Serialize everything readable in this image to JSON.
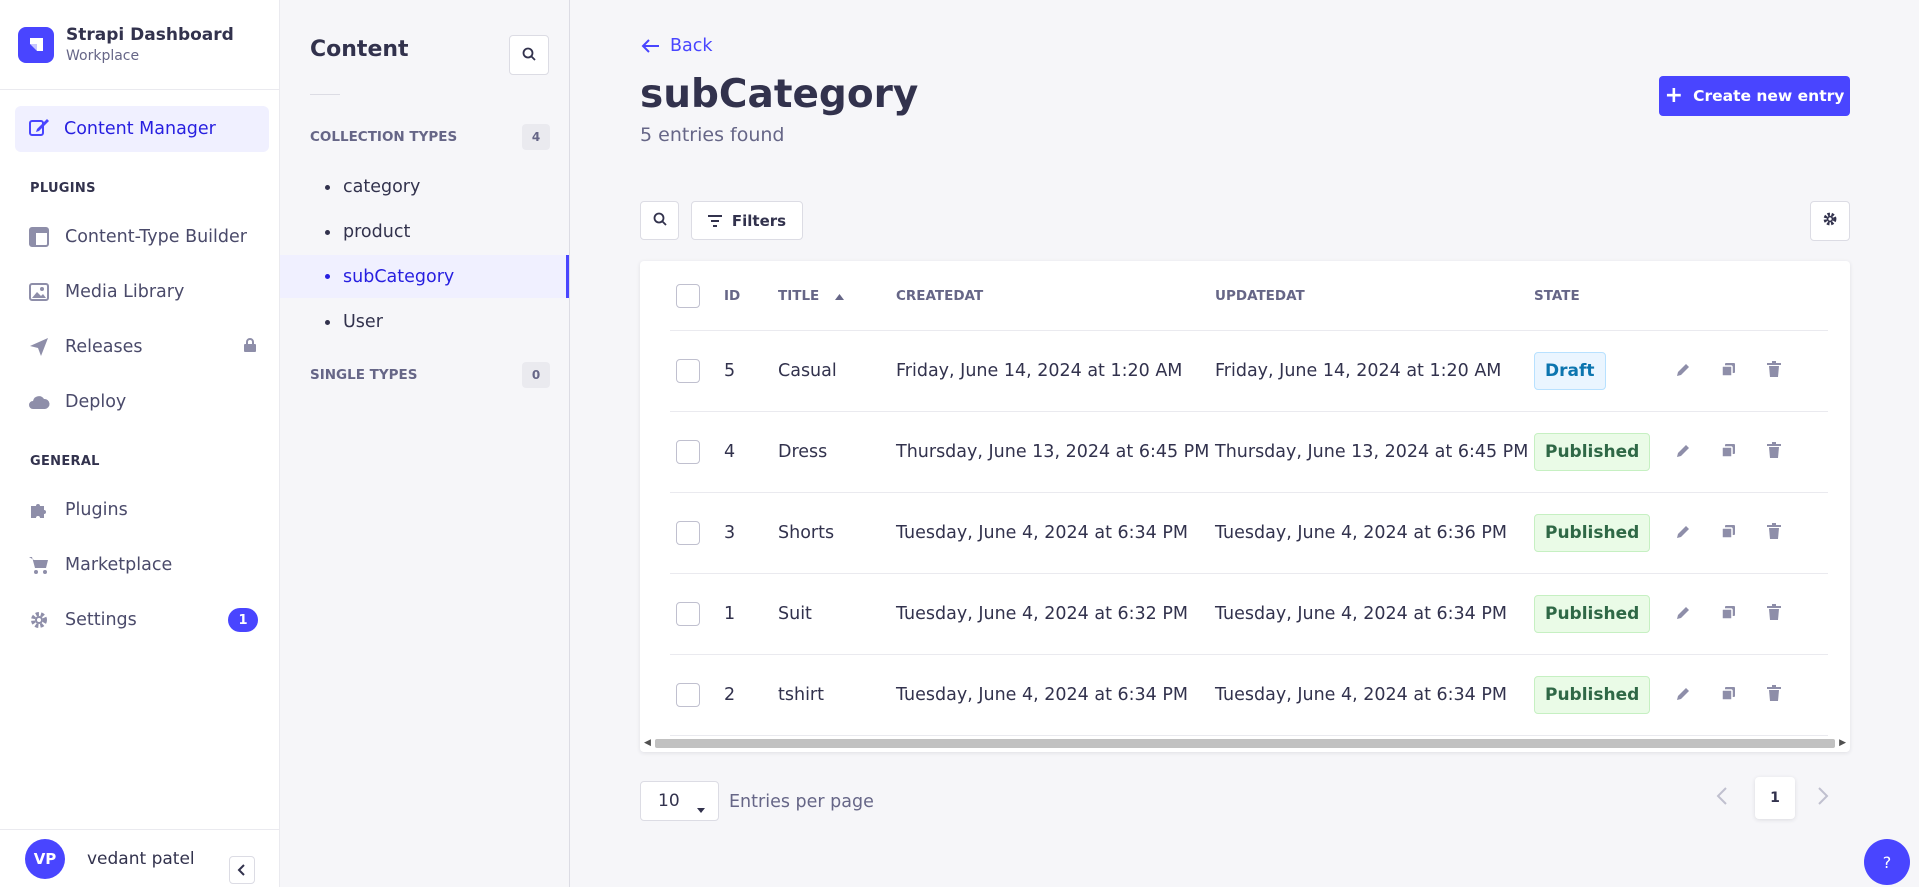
{
  "brand": {
    "title": "Strapi Dashboard",
    "subtitle": "Workplace"
  },
  "mainnav": {
    "active": {
      "label": "Content Manager",
      "icon": "feather-pen-icon"
    },
    "sections": {
      "plugins": "PLUGINS",
      "general": "GENERAL"
    },
    "plugins": [
      {
        "label": "Content-Type Builder",
        "icon": "layout-icon"
      },
      {
        "label": "Media Library",
        "icon": "image-icon"
      },
      {
        "label": "Releases",
        "icon": "paper-plane-icon",
        "trail_icon": "lock-icon"
      },
      {
        "label": "Deploy",
        "icon": "cloud-icon"
      }
    ],
    "general": [
      {
        "label": "Plugins",
        "icon": "puzzle-icon"
      },
      {
        "label": "Marketplace",
        "icon": "cart-icon"
      },
      {
        "label": "Settings",
        "icon": "gear-icon",
        "badge": "1"
      }
    ],
    "user": {
      "initials": "VP",
      "name": "vedant patel"
    }
  },
  "subnav": {
    "title": "Content",
    "collection_types": {
      "label": "COLLECTION TYPES",
      "count": "4"
    },
    "single_types": {
      "label": "SINGLE TYPES",
      "count": "0"
    },
    "items": [
      "category",
      "product",
      "subCategory",
      "User"
    ]
  },
  "header": {
    "back": "Back",
    "title": "subCategory",
    "subtitle": "5 entries found",
    "create": "Create new entry"
  },
  "toolbar": {
    "filters": "Filters"
  },
  "table": {
    "headers": {
      "id": "ID",
      "title": "TITLE",
      "created": "CREATEDAT",
      "updated": "UPDATEDAT",
      "state": "STATE"
    },
    "rows": [
      {
        "id": "5",
        "title": "Casual",
        "created": "Friday, June 14, 2024 at 1:20 AM",
        "updated": "Friday, June 14, 2024 at 1:20 AM",
        "state": "Draft"
      },
      {
        "id": "4",
        "title": "Dress",
        "created": "Thursday, June 13, 2024 at 6:45 PM",
        "updated": "Thursday, June 13, 2024 at 6:45 PM",
        "state": "Published"
      },
      {
        "id": "3",
        "title": "Shorts",
        "created": "Tuesday, June 4, 2024 at 6:34 PM",
        "updated": "Tuesday, June 4, 2024 at 6:36 PM",
        "state": "Published"
      },
      {
        "id": "1",
        "title": "Suit",
        "created": "Tuesday, June 4, 2024 at 6:32 PM",
        "updated": "Tuesday, June 4, 2024 at 6:34 PM",
        "state": "Published"
      },
      {
        "id": "2",
        "title": "tshirt",
        "created": "Tuesday, June 4, 2024 at 6:34 PM",
        "updated": "Tuesday, June 4, 2024 at 6:34 PM",
        "state": "Published"
      }
    ]
  },
  "pagination": {
    "per_page": "10",
    "per_page_label": "Entries per page",
    "current": "1"
  },
  "help": "?",
  "colors": {
    "primary": "#4945ff",
    "draft": "#0c75af",
    "published": "#2f6846"
  }
}
